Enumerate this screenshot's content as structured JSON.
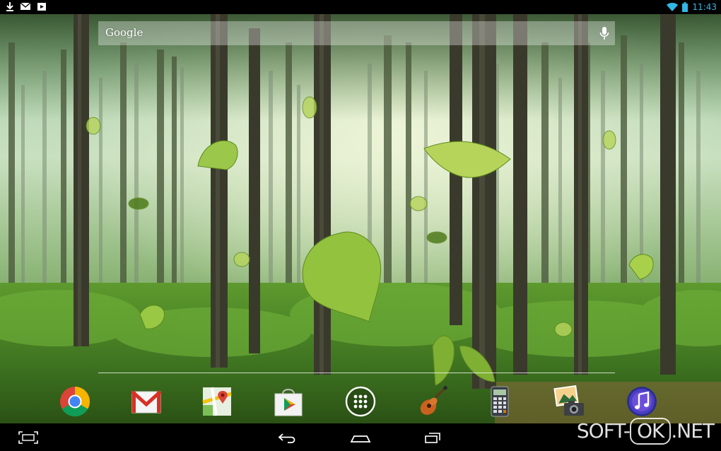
{
  "status_bar": {
    "time": "11:43",
    "left_icons": [
      "download-icon",
      "gmail-notification-icon",
      "play-store-notification-icon"
    ],
    "right_icons": [
      "wifi-icon",
      "battery-icon"
    ],
    "accent_color": "#33b5e5"
  },
  "search": {
    "logo_text": "Google",
    "icon": "mic-icon"
  },
  "dock": {
    "apps": [
      {
        "icon": "chrome-icon"
      },
      {
        "icon": "gmail-icon"
      },
      {
        "icon": "maps-icon"
      },
      {
        "icon": "play-store-icon"
      },
      {
        "icon": "app-drawer-icon"
      },
      {
        "icon": "guitar-icon"
      },
      {
        "icon": "calculator-icon"
      },
      {
        "icon": "gallery-camera-icon"
      },
      {
        "icon": "music-icon"
      }
    ]
  },
  "nav_bar": {
    "buttons": [
      "recent-apps-icon",
      "back-icon",
      "home-icon",
      "recents-icon"
    ]
  },
  "watermark": {
    "prefix": "SOFT-",
    "boxed": "OK",
    "suffix": ".NET"
  }
}
